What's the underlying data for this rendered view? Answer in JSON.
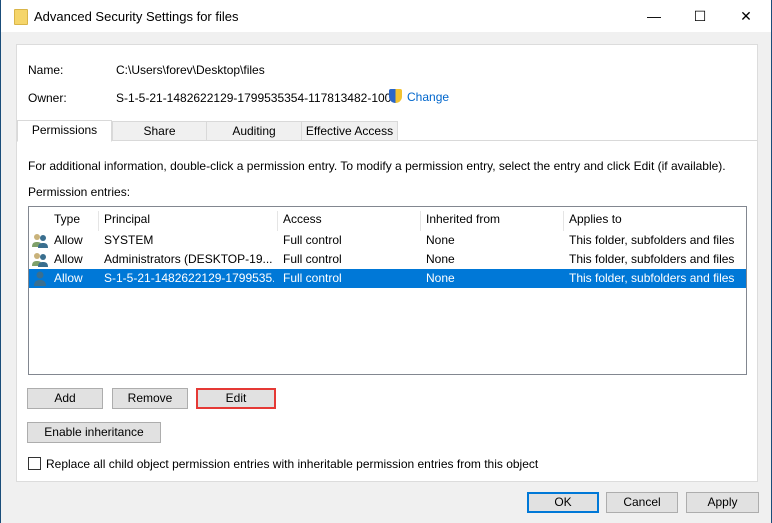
{
  "window": {
    "title": "Advanced Security Settings for files",
    "minimize": "—",
    "maximize": "☐",
    "close": "✕"
  },
  "name": {
    "label": "Name:",
    "value": "C:\\Users\\forev\\Desktop\\files"
  },
  "owner": {
    "label": "Owner:",
    "value": "S-1-5-21-1482622129-1799535354-117813482-1001",
    "change": "Change"
  },
  "tabs": [
    "Permissions",
    "Share",
    "Auditing",
    "Effective Access"
  ],
  "info": "For additional information, double-click a permission entry. To modify a permission entry, select the entry and click Edit (if available).",
  "entries_label": "Permission entries:",
  "columns": [
    "Type",
    "Principal",
    "Access",
    "Inherited from",
    "Applies to"
  ],
  "rows": [
    {
      "icon": "group-icon",
      "type": "Allow",
      "principal": "SYSTEM",
      "access": "Full control",
      "inherited": "None",
      "applies": "This folder, subfolders and files"
    },
    {
      "icon": "group-icon",
      "type": "Allow",
      "principal": "Administrators (DESKTOP-19...",
      "access": "Full control",
      "inherited": "None",
      "applies": "This folder, subfolders and files"
    },
    {
      "icon": "user-icon",
      "type": "Allow",
      "principal": "S-1-5-21-1482622129-1799535...",
      "access": "Full control",
      "inherited": "None",
      "applies": "This folder, subfolders and files",
      "selected": true
    }
  ],
  "buttons": {
    "add": "Add",
    "remove": "Remove",
    "edit": "Edit",
    "enable_inheritance": "Enable inheritance",
    "ok": "OK",
    "cancel": "Cancel",
    "apply": "Apply"
  },
  "replace_checkbox": {
    "label": "Replace all child object permission entries with inheritable permission entries from this object",
    "checked": false
  },
  "colors": {
    "selection": "#0078d7",
    "highlight": "#e53935",
    "link": "#0066cc"
  }
}
